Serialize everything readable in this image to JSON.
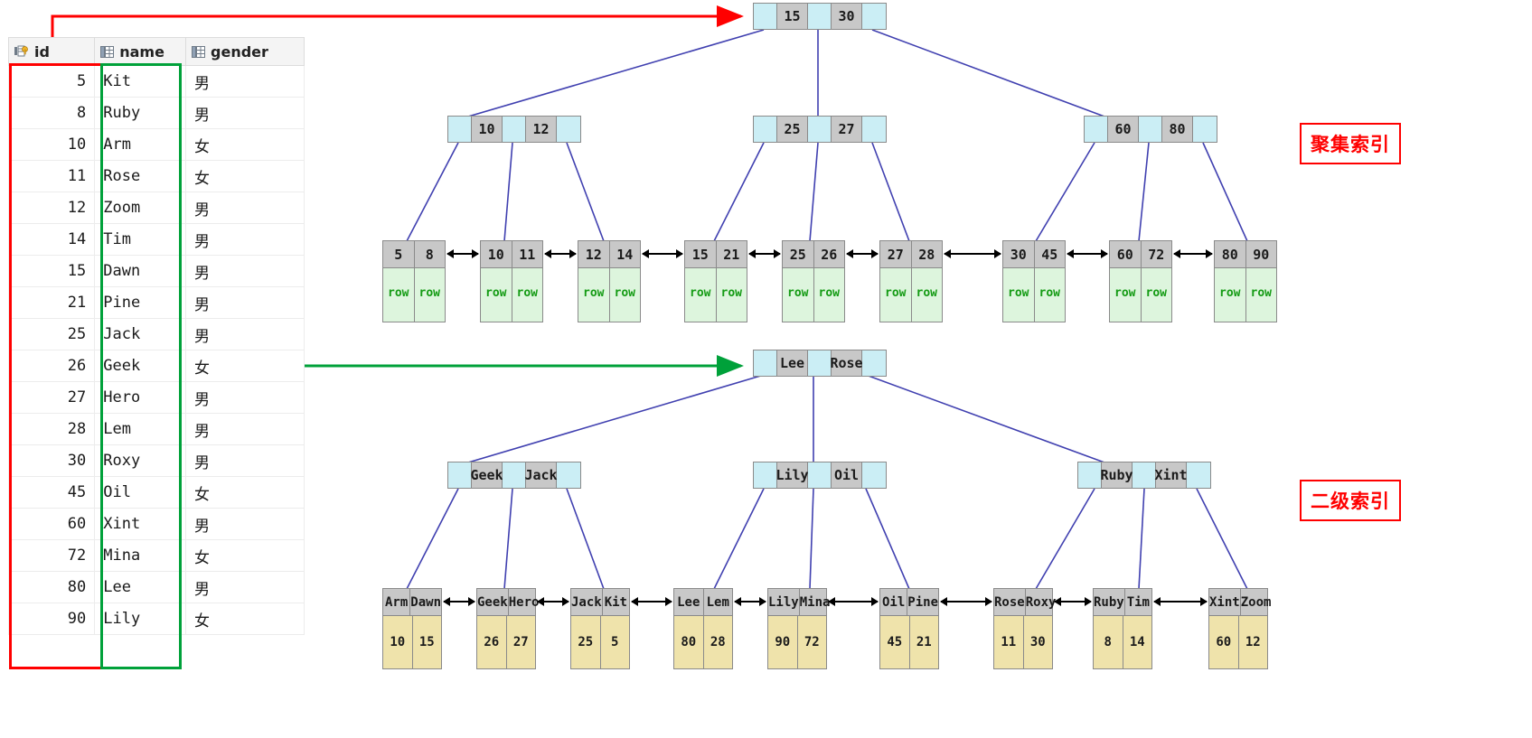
{
  "table": {
    "columns": [
      {
        "key": "id",
        "label": "id",
        "icon": "primary-key-icon"
      },
      {
        "key": "name",
        "label": "name",
        "icon": "table-column-icon"
      },
      {
        "key": "gender",
        "label": "gender",
        "icon": "table-column-icon"
      }
    ],
    "rows": [
      {
        "id": "5",
        "name": "Kit",
        "gender": "男"
      },
      {
        "id": "8",
        "name": "Ruby",
        "gender": "男"
      },
      {
        "id": "10",
        "name": "Arm",
        "gender": "女"
      },
      {
        "id": "11",
        "name": "Rose",
        "gender": "女"
      },
      {
        "id": "12",
        "name": "Zoom",
        "gender": "男"
      },
      {
        "id": "14",
        "name": "Tim",
        "gender": "男"
      },
      {
        "id": "15",
        "name": "Dawn",
        "gender": "男"
      },
      {
        "id": "21",
        "name": "Pine",
        "gender": "男"
      },
      {
        "id": "25",
        "name": "Jack",
        "gender": "男"
      },
      {
        "id": "26",
        "name": "Geek",
        "gender": "女"
      },
      {
        "id": "27",
        "name": "Hero",
        "gender": "男"
      },
      {
        "id": "28",
        "name": "Lem",
        "gender": "男"
      },
      {
        "id": "30",
        "name": "Roxy",
        "gender": "男"
      },
      {
        "id": "45",
        "name": "Oil",
        "gender": "女"
      },
      {
        "id": "60",
        "name": "Xint",
        "gender": "男"
      },
      {
        "id": "72",
        "name": "Mina",
        "gender": "女"
      },
      {
        "id": "80",
        "name": "Lee",
        "gender": "男"
      },
      {
        "id": "90",
        "name": "Lily",
        "gender": "女"
      }
    ],
    "highlight_id_color": "#ff0000",
    "highlight_name_color": "#00a13a"
  },
  "labels": {
    "clustered_index": "聚集索引",
    "secondary_index": "二级索引"
  },
  "colors": {
    "node_key_fill": "#c8c8c8",
    "node_pointer_fill": "#cbeef5",
    "clustered_row_fill": "#ddf5dd",
    "clustered_row_text": "#149b14",
    "secondary_value_fill": "#efe3ab",
    "edge": "#4040b0",
    "red_arrow": "#ff0000",
    "green_arrow": "#00a13a"
  },
  "clustered": {
    "root": {
      "keys": [
        "15",
        "30"
      ]
    },
    "internal": [
      {
        "keys": [
          "10",
          "12"
        ]
      },
      {
        "keys": [
          "25",
          "27"
        ]
      },
      {
        "keys": [
          "60",
          "80"
        ]
      }
    ],
    "leaves": [
      {
        "keys": [
          "5",
          "8"
        ],
        "values": [
          "row",
          "row"
        ]
      },
      {
        "keys": [
          "10",
          "11"
        ],
        "values": [
          "row",
          "row"
        ]
      },
      {
        "keys": [
          "12",
          "14"
        ],
        "values": [
          "row",
          "row"
        ]
      },
      {
        "keys": [
          "15",
          "21"
        ],
        "values": [
          "row",
          "row"
        ]
      },
      {
        "keys": [
          "25",
          "26"
        ],
        "values": [
          "row",
          "row"
        ]
      },
      {
        "keys": [
          "27",
          "28"
        ],
        "values": [
          "row",
          "row"
        ]
      },
      {
        "keys": [
          "30",
          "45"
        ],
        "values": [
          "row",
          "row"
        ]
      },
      {
        "keys": [
          "60",
          "72"
        ],
        "values": [
          "row",
          "row"
        ]
      },
      {
        "keys": [
          "80",
          "90"
        ],
        "values": [
          "row",
          "row"
        ]
      }
    ]
  },
  "secondary": {
    "root": {
      "keys": [
        "Lee",
        "Rose"
      ]
    },
    "internal": [
      {
        "keys": [
          "Geek",
          "Jack"
        ]
      },
      {
        "keys": [
          "Lily",
          "Oil"
        ]
      },
      {
        "keys": [
          "Ruby",
          "Xint"
        ]
      }
    ],
    "leaves": [
      {
        "keys": [
          "Arm",
          "Dawn"
        ],
        "values": [
          "10",
          "15"
        ]
      },
      {
        "keys": [
          "Geek",
          "Hero"
        ],
        "values": [
          "26",
          "27"
        ]
      },
      {
        "keys": [
          "Jack",
          "Kit"
        ],
        "values": [
          "25",
          "5"
        ]
      },
      {
        "keys": [
          "Lee",
          "Lem"
        ],
        "values": [
          "80",
          "28"
        ]
      },
      {
        "keys": [
          "Lily",
          "Mina"
        ],
        "values": [
          "90",
          "72"
        ]
      },
      {
        "keys": [
          "Oil",
          "Pine"
        ],
        "values": [
          "45",
          "21"
        ]
      },
      {
        "keys": [
          "Rose",
          "Roxy"
        ],
        "values": [
          "11",
          "30"
        ]
      },
      {
        "keys": [
          "Ruby",
          "Tim"
        ],
        "values": [
          "8",
          "14"
        ]
      },
      {
        "keys": [
          "Xint",
          "Zoom"
        ],
        "values": [
          "60",
          "12"
        ]
      }
    ]
  }
}
